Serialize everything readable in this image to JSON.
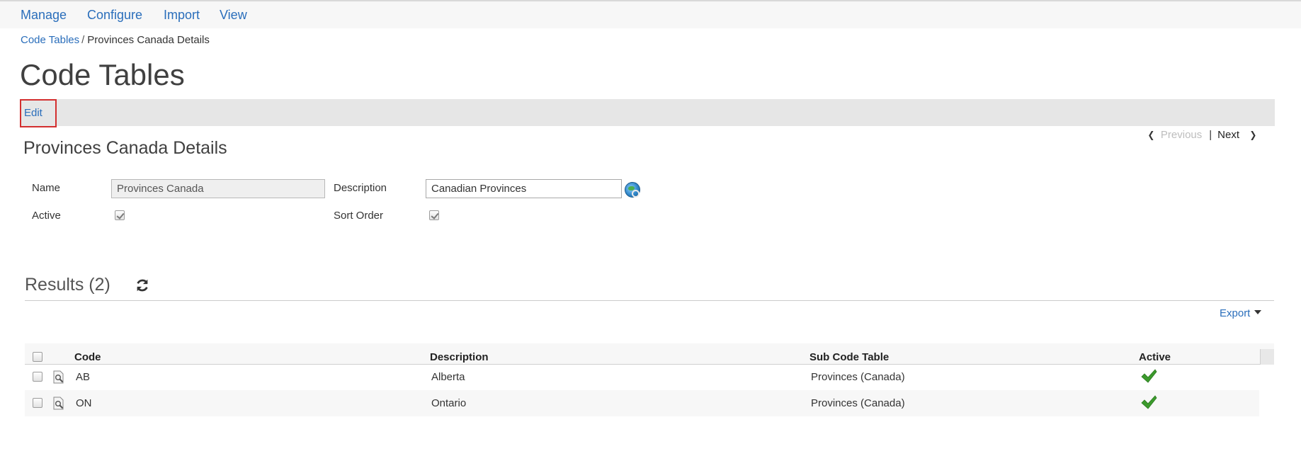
{
  "nav": {
    "items": [
      "Manage",
      "Configure",
      "Import",
      "View"
    ]
  },
  "breadcrumb": {
    "parent": "Code Tables",
    "separator": "/",
    "current": "Provinces Canada Details"
  },
  "page_title": "Code Tables",
  "toolbar": {
    "edit_label": "Edit"
  },
  "pager": {
    "previous_label": "Previous",
    "separator": "|",
    "next_label": "Next"
  },
  "details": {
    "title": "Provinces Canada Details",
    "name_label": "Name",
    "name_value": "Provinces Canada",
    "description_label": "Description",
    "description_value": "Canadian Provinces",
    "active_label": "Active",
    "active_checked": true,
    "sort_order_label": "Sort Order",
    "sort_order_checked": true
  },
  "results": {
    "title": "Results (2)",
    "export_label": "Export",
    "columns": [
      "Code",
      "Description",
      "Sub Code Table",
      "Active"
    ],
    "rows": [
      {
        "code": "AB",
        "description": "Alberta",
        "sub_code_table": "Provinces (Canada)",
        "active": true
      },
      {
        "code": "ON",
        "description": "Ontario",
        "sub_code_table": "Provinces (Canada)",
        "active": true
      }
    ]
  },
  "colors": {
    "link": "#2a6ebb",
    "highlight_border": "#d32f2f",
    "toolbar_bg": "#e6e6e6",
    "active_check": "#3c9a2c"
  }
}
